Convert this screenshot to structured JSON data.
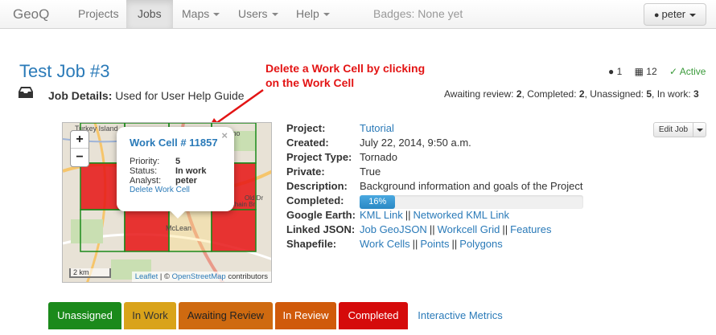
{
  "navbar": {
    "brand": "GeoQ",
    "items": [
      "Projects",
      "Jobs",
      "Maps",
      "Users",
      "Help"
    ],
    "badges": "Badges: None yet",
    "user": "peter"
  },
  "job": {
    "title": "Test Job #3",
    "details_label": "Job Details:",
    "details_value": "Used for User Help Guide"
  },
  "annotation": {
    "line1": "Delete a Work Cell by clicking",
    "line2": "on the Work Cell"
  },
  "counters": {
    "users": "1",
    "cells": "12",
    "status": "Active"
  },
  "summary": {
    "awaiting_label": "Awaiting review:",
    "awaiting": "2",
    "completed_label": "Completed:",
    "completed": "2",
    "unassigned_label": "Unassigned:",
    "unassigned": "5",
    "inwork_label": "In work:",
    "inwork": "3"
  },
  "map": {
    "zoom_in": "+",
    "zoom_out": "−",
    "scale": "2 km",
    "attribution_leaflet": "Leaflet",
    "attribution_sep": "| ©",
    "attribution_osm": "OpenStreetMap",
    "attribution_tail": "contributors",
    "popup": {
      "close": "×",
      "title": "Work Cell # 11857",
      "priority_label": "Priority:",
      "priority": "5",
      "status_label": "Status:",
      "status": "In work",
      "analyst_label": "Analyst:",
      "analyst": "peter",
      "delete_link": "Delete Work Cell"
    },
    "place_labels": [
      "Turkey Island",
      "Echo",
      "McLean",
      "Chain Br",
      "Old Dr"
    ],
    "grid_state": [
      [
        "none",
        "none",
        "none",
        "none"
      ],
      [
        "in_work",
        "in_work",
        "none",
        "in_work"
      ],
      [
        "none",
        "completed",
        "unassigned",
        "completed"
      ],
      [
        "none",
        "none",
        "none",
        "none"
      ]
    ]
  },
  "properties": {
    "project_label": "Project:",
    "project": "Tutorial",
    "created_label": "Created:",
    "created": "July 22, 2014, 9:50 a.m.",
    "type_label": "Project Type:",
    "type": "Tornado",
    "private_label": "Private:",
    "private": "True",
    "description_label": "Description:",
    "description": "Background information and goals of the Project",
    "completed_label": "Completed:",
    "completed_pct": 16,
    "completed_text": "16%",
    "ge_label": "Google Earth:",
    "ge_link1": "KML Link",
    "ge_link2": "Networked KML Link",
    "json_label": "Linked JSON:",
    "json_link1": "Job GeoJSON",
    "json_link2": "Workcell Grid",
    "json_link3": "Features",
    "shp_label": "Shapefile:",
    "shp_link1": "Work Cells",
    "shp_link2": "Points",
    "shp_link3": "Polygons",
    "sep": "||"
  },
  "edit": {
    "label": "Edit Job"
  },
  "tabs": [
    {
      "label": "Unassigned",
      "bg": "#1b8a1b",
      "fg": "#ffffff"
    },
    {
      "label": "In Work",
      "bg": "#d9a31a",
      "fg": "#333333"
    },
    {
      "label": "Awaiting Review",
      "bg": "#cf6a10",
      "fg": "#222222"
    },
    {
      "label": "In Review",
      "bg": "#d05a0a",
      "fg": "#ffffff"
    },
    {
      "label": "Completed",
      "bg": "#d50a0a",
      "fg": "#ffffff"
    },
    {
      "label": "Interactive Metrics",
      "bg": "",
      "fg": "#2a7ab8"
    }
  ],
  "colors": {
    "link": "#2a7ab8",
    "annotation": "#e31414",
    "active": "#3a9a3a"
  }
}
